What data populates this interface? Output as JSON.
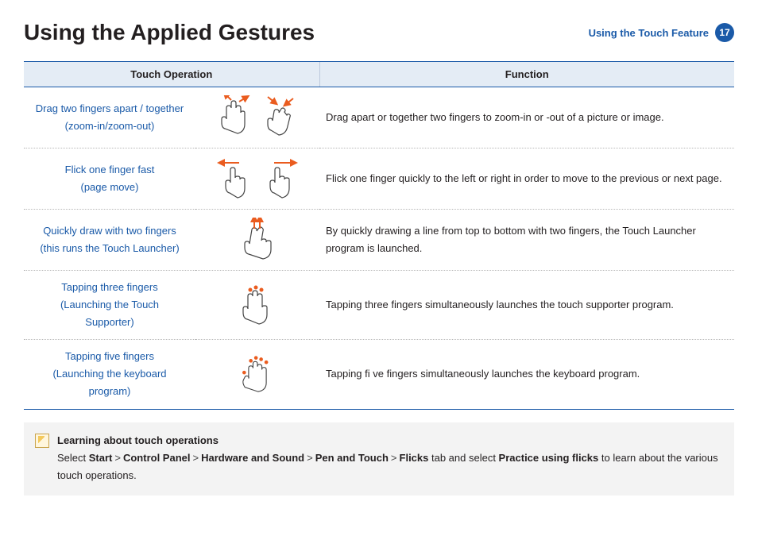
{
  "header": {
    "title": "Using the Applied Gestures",
    "section": "Using the Touch Feature",
    "page": "17"
  },
  "table": {
    "head_op": "Touch Operation",
    "head_fn": "Function",
    "rows": [
      {
        "label_l1": "Drag two fingers apart / together",
        "label_l2": "(zoom-in/zoom-out)",
        "func": "Drag apart or together two fingers to zoom-in or -out of a picture or image."
      },
      {
        "label_l1": "Flick one finger fast",
        "label_l2": "(page move)",
        "func": "Flick one finger quickly to the left or right in order to move to the previous or next page."
      },
      {
        "label_l1": "Quickly draw with two fingers",
        "label_l2": "(this runs the Touch Launcher)",
        "func": "By quickly drawing a line from top to bottom with two fingers, the Touch Launcher program is launched."
      },
      {
        "label_l1": "Tapping three fingers",
        "label_l2": "(Launching the Touch",
        "label_l3": "Supporter)",
        "func": "Tapping three fingers simultaneously launches the touch supporter program."
      },
      {
        "label_l1": "Tapping five fingers",
        "label_l2": "(Launching the keyboard",
        "label_l3": "program)",
        "func": "Tapping fi ve fingers simultaneously launches the keyboard program."
      }
    ]
  },
  "note": {
    "heading": "Learning about touch operations",
    "pre": "Select ",
    "path": [
      "Start",
      "Control Panel",
      "Hardware and Sound",
      "Pen and Touch",
      "Flicks"
    ],
    "mid": " tab and select ",
    "action": "Practice using flicks",
    "post": " to learn about the various touch operations."
  }
}
